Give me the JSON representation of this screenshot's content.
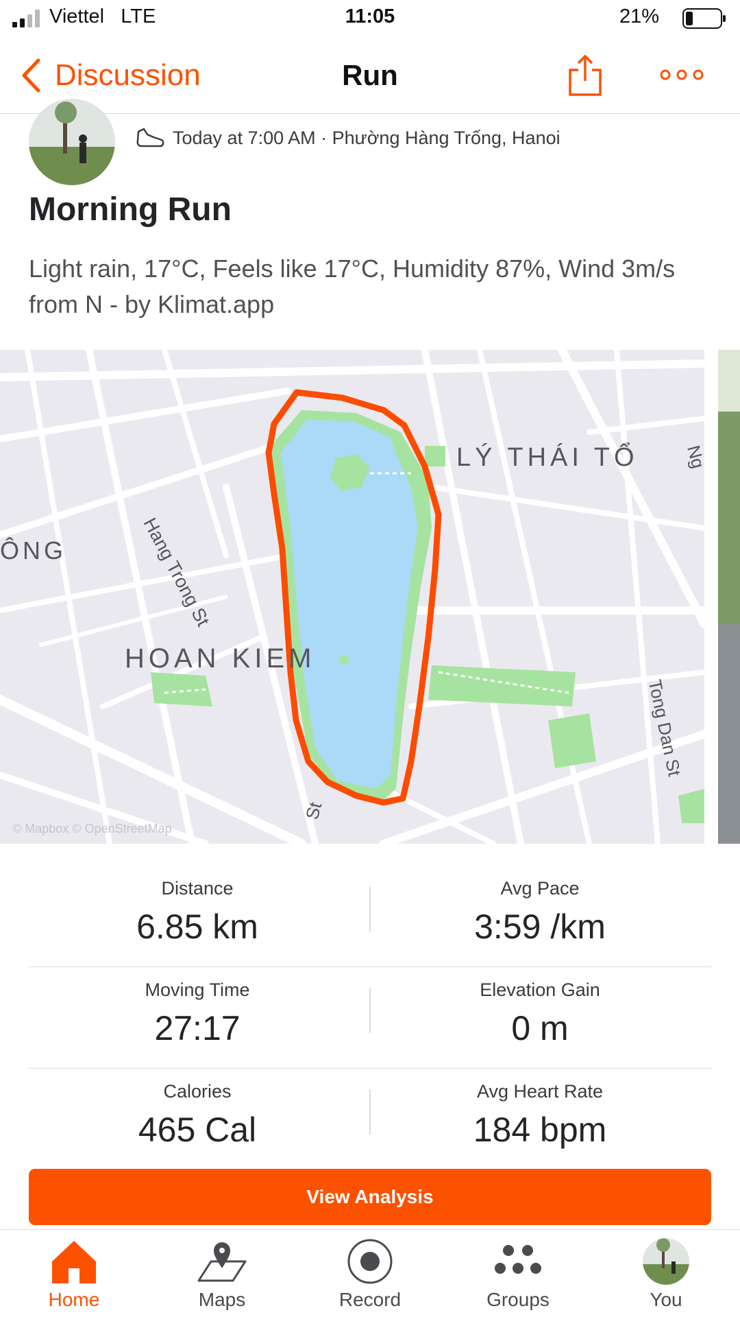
{
  "status_bar": {
    "carrier": "Viettel   LTE",
    "time": "11:05",
    "battery": "21%"
  },
  "nav": {
    "back_label": "Discussion",
    "title": "Run",
    "icons": [
      "chevron-left-icon",
      "share-icon",
      "more-icon"
    ]
  },
  "activity": {
    "meta": "Today at 7:00 AM · Phường Hàng Trống, Hanoi",
    "title": "Morning Run",
    "description": "Light rain, 17°C, Feels like 17°C, Humidity 87%, Wind 3m/s from N - by Klimat.app",
    "sport_icon": "shoe-icon"
  },
  "map": {
    "labels": {
      "ly_thai_to": "LÝ THÁI TỔ",
      "hang_trong": "Hang Trong St",
      "ong": "ÔNG",
      "hoan_kiem": "HOAN KIEM",
      "tong_dan": "Tong Dan St",
      "st_bottom": "St",
      "ng_right": "Ng",
      "attribution": "© Mapbox © OpenStreetMap"
    },
    "route_color": "#fc4c02",
    "water_color": "#aadaf7",
    "park_color": "#a6e3a0"
  },
  "stats": [
    {
      "left": {
        "label": "Distance",
        "value": "6.85 km"
      },
      "right": {
        "label": "Avg Pace",
        "value": "3:59 /km"
      }
    },
    {
      "left": {
        "label": "Moving Time",
        "value": "27:17"
      },
      "right": {
        "label": "Elevation Gain",
        "value": "0 m"
      }
    },
    {
      "left": {
        "label": "Calories",
        "value": "465 Cal"
      },
      "right": {
        "label": "Avg Heart Rate",
        "value": "184 bpm"
      }
    }
  ],
  "actions": {
    "view_analysis": "View Analysis"
  },
  "tabs": [
    {
      "label": "Home",
      "icon": "home-icon",
      "active": true
    },
    {
      "label": "Maps",
      "icon": "map-pin-icon",
      "active": false
    },
    {
      "label": "Record",
      "icon": "record-icon",
      "active": false
    },
    {
      "label": "Groups",
      "icon": "groups-icon",
      "active": false
    },
    {
      "label": "You",
      "icon": "profile-avatar",
      "active": false
    }
  ],
  "colors": {
    "accent": "#fc5200",
    "text": "#242428"
  }
}
